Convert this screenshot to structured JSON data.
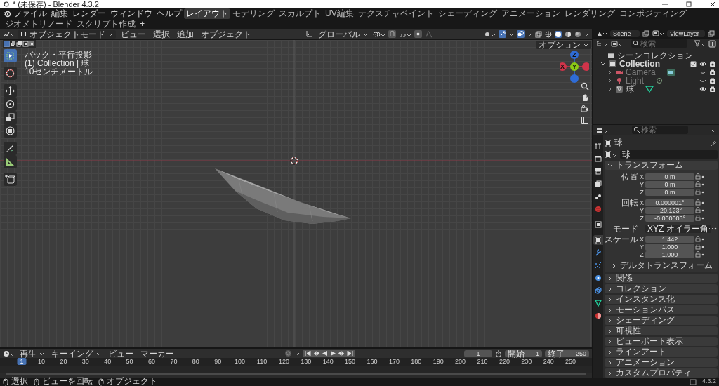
{
  "window": {
    "title": "* (未保存) - Blender 4.3.2"
  },
  "menu_bar": {
    "menus": [
      "ファイル",
      "編集",
      "レンダー",
      "ウィンドウ",
      "ヘルプ"
    ],
    "workspaces": [
      {
        "label": "レイアウト",
        "selected": true
      },
      {
        "label": "モデリング",
        "selected": false
      },
      {
        "label": "スカルプト",
        "selected": false
      },
      {
        "label": "UV編集",
        "selected": false
      },
      {
        "label": "テクスチャペイント",
        "selected": false
      },
      {
        "label": "シェーディング",
        "selected": false
      },
      {
        "label": "アニメーション",
        "selected": false
      },
      {
        "label": "レンダリング",
        "selected": false
      },
      {
        "label": "コンポジティング",
        "selected": false
      },
      {
        "label": "ジオメトリノード",
        "selected": false
      },
      {
        "label": "スクリプト作成",
        "selected": false
      }
    ],
    "add_workspace": "+",
    "scene": "Scene",
    "view_layer": "ViewLayer"
  },
  "viewport": {
    "mode": "オブジェクトモード",
    "menus": [
      "ビュー",
      "選択",
      "追加",
      "オブジェクト"
    ],
    "orientation": "グローバル",
    "options": "オプション",
    "overlay_text": [
      "バック・平行投影",
      "(1) Collection | 球",
      "10センチメートル"
    ],
    "tools": [
      {
        "kind": "select",
        "selected": true
      },
      {
        "kind": "cursor",
        "selected": false
      },
      {
        "kind": "move",
        "selected": false
      },
      {
        "kind": "rotate",
        "selected": false
      },
      {
        "kind": "scale",
        "selected": false
      },
      {
        "kind": "transform",
        "selected": false
      },
      {
        "kind": "annotate",
        "selected": false
      },
      {
        "kind": "measure",
        "selected": false
      },
      {
        "kind": "add-cube",
        "selected": false
      }
    ],
    "gizmo": [
      {
        "kind": "z",
        "label": "Z",
        "color": "#2f6cd6"
      },
      {
        "kind": "x",
        "label": "X",
        "color": "#d0344a"
      },
      {
        "kind": "neg-x",
        "color": "#d0344a"
      },
      {
        "kind": "neg-z",
        "color": "#2f6cd6"
      },
      {
        "kind": "y",
        "label": "Y",
        "color": "#8bc916"
      }
    ]
  },
  "outliner": {
    "search_placeholder": "検索",
    "root": "シーンコレクション",
    "tree": [
      {
        "label": "Collection",
        "expanded": true,
        "checked": true,
        "visible": true,
        "children": [
          {
            "label": "Camera",
            "kind": "camera",
            "expanded": false,
            "visible": false
          },
          {
            "label": "Light",
            "kind": "light",
            "expanded": false,
            "visible": false
          },
          {
            "label": "球",
            "kind": "mesh",
            "expanded": false,
            "visible": true
          }
        ]
      }
    ]
  },
  "properties": {
    "search_placeholder": "検索",
    "tabs": [
      {
        "kind": "tool",
        "selected": false
      },
      {
        "kind": "render",
        "selected": false
      },
      {
        "kind": "output",
        "selected": false
      },
      {
        "kind": "view-layer",
        "selected": false
      },
      {
        "kind": "scene",
        "selected": false
      },
      {
        "kind": "world",
        "selected": false
      },
      {
        "kind": "collection",
        "selected": false
      },
      {
        "kind": "object",
        "selected": true
      },
      {
        "kind": "modifier",
        "selected": false
      },
      {
        "kind": "particles",
        "selected": false
      },
      {
        "kind": "physics",
        "selected": false
      },
      {
        "kind": "constraints",
        "selected": false
      },
      {
        "kind": "data",
        "selected": false
      },
      {
        "kind": "material",
        "selected": false
      }
    ],
    "object_title": "球",
    "object_name": "球",
    "transform": {
      "title": "トランスフォーム",
      "expanded": true,
      "rows": [
        {
          "kind": "vector",
          "label": "位置",
          "axes": [
            {
              "axis": "X",
              "value": "0 m"
            },
            {
              "axis": "Y",
              "value": "0 m"
            },
            {
              "axis": "Z",
              "value": "0 m"
            }
          ]
        },
        {
          "kind": "vector",
          "label": "回転",
          "axes": [
            {
              "axis": "X",
              "value": "0.000001°"
            },
            {
              "axis": "Y",
              "value": "-20.123°"
            },
            {
              "axis": "Z",
              "value": "-0.000003°"
            }
          ]
        },
        {
          "kind": "enum",
          "label": "モード",
          "value": "XYZ オイラー角"
        },
        {
          "kind": "vector",
          "label": "スケール",
          "axes": [
            {
              "axis": "X",
              "value": "1.442"
            },
            {
              "axis": "Y",
              "value": "1.000"
            },
            {
              "axis": "Z",
              "value": "1.000"
            }
          ]
        }
      ],
      "subpanel": {
        "title": "デルタトランスフォーム",
        "expanded": false
      }
    },
    "panels": [
      {
        "title": "関係",
        "expanded": false
      },
      {
        "title": "コレクション",
        "expanded": false
      },
      {
        "title": "インスタンス化",
        "expanded": false
      },
      {
        "title": "モーションパス",
        "expanded": false
      },
      {
        "title": "シェーディング",
        "expanded": false
      },
      {
        "title": "可視性",
        "expanded": false
      },
      {
        "title": "ビューポート表示",
        "expanded": false
      },
      {
        "title": "ラインアート",
        "expanded": false
      },
      {
        "title": "アニメーション",
        "expanded": false
      },
      {
        "title": "カスタムプロパティ",
        "expanded": false
      }
    ]
  },
  "timeline": {
    "menus": [
      "再生",
      "キーイング",
      "ビュー",
      "マーカー"
    ],
    "current_frame": "1",
    "start_label": "開始",
    "start": "1",
    "end_label": "終了",
    "end": "250",
    "playhead": "1",
    "ruler": [
      "10",
      "20",
      "30",
      "40",
      "50",
      "60",
      "70",
      "80",
      "90",
      "100",
      "110",
      "120",
      "130",
      "140",
      "150",
      "160",
      "170",
      "180",
      "190",
      "200",
      "210",
      "220",
      "230",
      "240",
      "250"
    ]
  },
  "status_bar": {
    "items": [
      {
        "kind": "left-click",
        "label": "選択"
      },
      {
        "kind": "middle-click",
        "label": "ビューを回転"
      },
      {
        "kind": "right-click",
        "label": "オブジェクト"
      }
    ],
    "version": "4.3.2"
  }
}
